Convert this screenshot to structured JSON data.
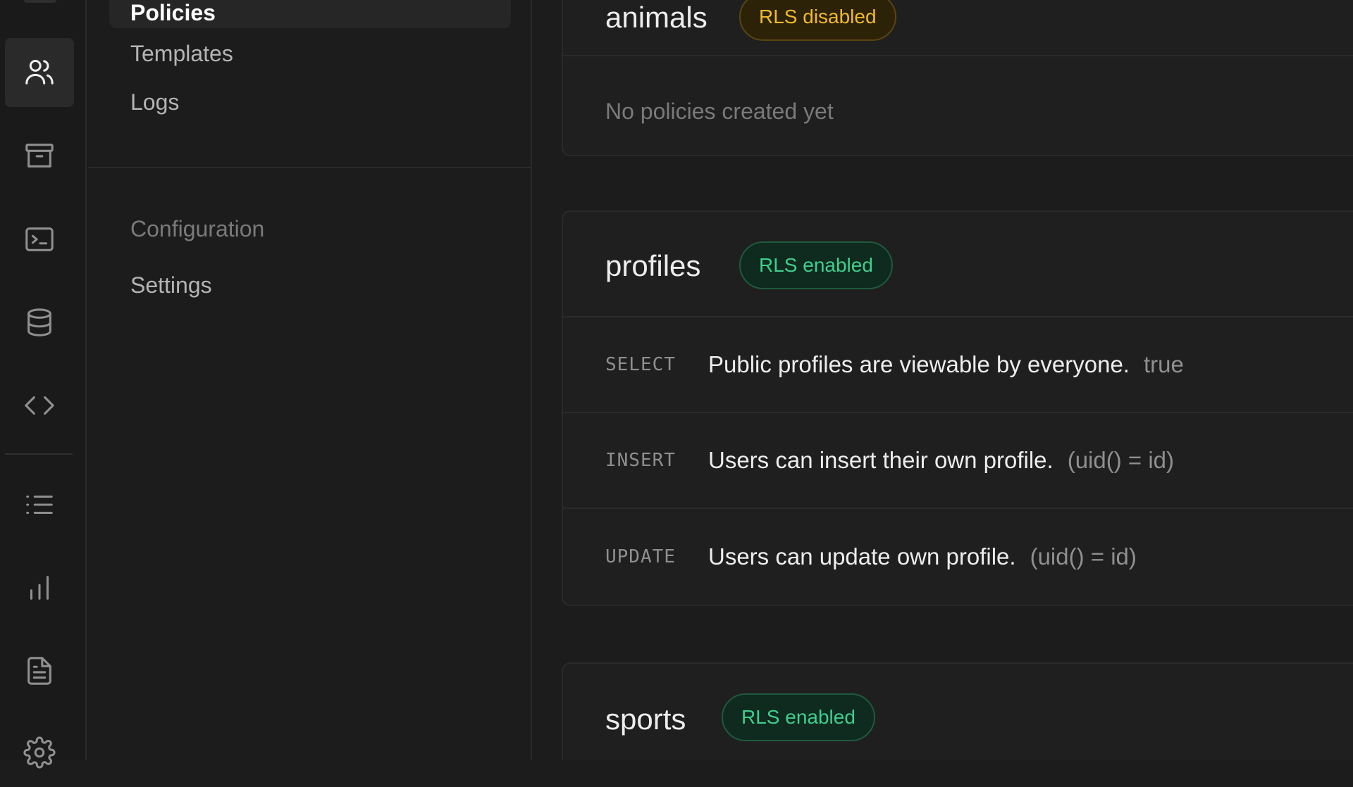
{
  "rail": {
    "items": [
      {
        "name": "users-icon",
        "active": true
      },
      {
        "name": "archive-icon"
      },
      {
        "name": "terminal-icon"
      },
      {
        "name": "database-icon"
      },
      {
        "name": "code-icon"
      },
      {
        "name": "list-icon"
      },
      {
        "name": "bar-chart-icon"
      },
      {
        "name": "document-icon"
      },
      {
        "name": "gear-icon"
      }
    ]
  },
  "menu": {
    "items": [
      {
        "label": "Policies",
        "active": true
      },
      {
        "label": "Templates"
      },
      {
        "label": "Logs"
      }
    ],
    "configuration": {
      "heading": "Configuration",
      "items": [
        {
          "label": "Settings"
        }
      ]
    }
  },
  "tables": [
    {
      "name": "animals",
      "badge": "RLS disabled",
      "status": "disabled",
      "empty_text": "No policies created yet"
    },
    {
      "name": "profiles",
      "badge": "RLS enabled",
      "status": "enabled",
      "policies": [
        {
          "command": "SELECT",
          "name": "Public profiles are viewable by everyone.",
          "definition": "true"
        },
        {
          "command": "INSERT",
          "name": "Users can insert their own profile.",
          "definition": "(uid() = id)"
        },
        {
          "command": "UPDATE",
          "name": "Users can update own profile.",
          "definition": "(uid() = id)"
        }
      ]
    },
    {
      "name": "sports",
      "badge": "RLS enabled",
      "status": "enabled"
    }
  ],
  "colors": {
    "background": "#1c1c1c",
    "enabled": "#3ecf8e",
    "disabled": "#f1b92c"
  }
}
